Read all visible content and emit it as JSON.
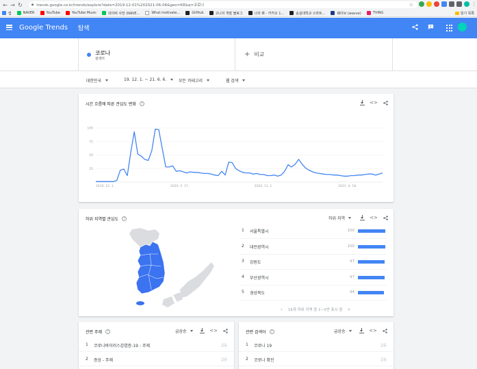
{
  "browser": {
    "url": "trends.google.co.kr/trends/explore?date=2019-12-01%202021-06-06&geo=KR&q=코로나",
    "bookmarks": [
      {
        "label": "앱",
        "color": "#4285f4"
      },
      {
        "label": "NAVER",
        "color": "#03c75a"
      },
      {
        "label": "YouTube",
        "color": "#ff0000"
      },
      {
        "label": "YouTube Music",
        "color": "#ff0000"
      },
      {
        "label": "네이버 사전 (NAVE...",
        "color": "#03c75a"
      },
      {
        "label": "What motivate...",
        "color": "#ffffff"
      },
      {
        "label": "GitHub",
        "color": "#202124"
      },
      {
        "label": "고니의 개발 블로그",
        "color": "#202124"
      },
      {
        "label": "나의 뽀 - 카카오 1...",
        "color": "#202124"
      },
      {
        "label": "숭실대학교 스마트...",
        "color": "#202124"
      },
      {
        "label": "웨이브 (wavve)",
        "color": "#1e3a8a"
      },
      {
        "label": "TVING",
        "color": "#e91e63"
      }
    ],
    "other_bookmarks": "읽기 목록"
  },
  "header": {
    "logo_google": "Google",
    "logo_trends": "Trends",
    "title": "탐색"
  },
  "term": {
    "name": "코로나",
    "type": "검색어",
    "color": "#4285f4",
    "compare_label": "비교"
  },
  "filters": {
    "region": "대한민국",
    "date": "19. 12. 1. ~ 21. 6. 6.",
    "category": "모든 카테고리",
    "search_type": "웹 검색"
  },
  "interest_over_time": {
    "title": "시간 흐름에 따른 관심도 변화"
  },
  "chart_data": {
    "type": "line",
    "ylim": [
      0,
      100
    ],
    "yticks": [
      25,
      50,
      75,
      100
    ],
    "x_tick_labels": [
      "2019. 12. 1.",
      "2020. 5. 17.",
      "2020. 11. 1.",
      "2021. 4. 18."
    ],
    "x_tick_index": [
      0,
      24,
      48,
      72
    ],
    "grid": true,
    "series": [
      {
        "color": "#4285f4",
        "values": [
          1,
          1,
          1,
          1,
          1,
          1,
          3,
          22,
          24,
          12,
          55,
          93,
          52,
          48,
          42,
          40,
          58,
          98,
          97,
          62,
          28,
          28,
          30,
          20,
          21,
          19,
          17,
          19,
          18,
          18,
          17,
          16,
          16,
          15,
          13,
          12,
          20,
          13,
          37,
          36,
          25,
          21,
          18,
          17,
          17,
          15,
          16,
          14,
          14,
          12,
          12,
          13,
          11,
          13,
          20,
          32,
          28,
          33,
          42,
          33,
          26,
          22,
          19,
          17,
          16,
          15,
          14,
          14,
          13,
          13,
          12,
          11,
          11,
          12,
          12,
          13,
          13,
          14,
          15,
          15,
          13,
          15,
          17
        ]
      }
    ]
  },
  "region": {
    "title": "하위 지역별 관심도",
    "subregion_label": "하위 지역",
    "items": [
      {
        "rank": "1",
        "name": "서울특별시",
        "value": 100
      },
      {
        "rank": "2",
        "name": "대전광역시",
        "value": 100
      },
      {
        "rank": "3",
        "name": "강원도",
        "value": 97
      },
      {
        "rank": "4",
        "name": "부산광역시",
        "value": 97
      },
      {
        "rank": "5",
        "name": "경상북도",
        "value": 94
      }
    ],
    "pager_text": "16개 하위 지역 중 1~5번 표시 중"
  },
  "related_topics": {
    "title": "관련 주제",
    "metric": "급상승",
    "items": [
      {
        "rank": "1",
        "name": "코로나바이러스감염증-19 - 주제",
        "value": "급등"
      },
      {
        "rank": "2",
        "name": "증상 - 주제",
        "value": "급등"
      }
    ]
  },
  "related_queries": {
    "title": "관련 검색어",
    "metric": "급상승",
    "items": [
      {
        "rank": "1",
        "name": "코로나 19",
        "value": "급등"
      },
      {
        "rank": "2",
        "name": "코로나 확진",
        "value": "급등"
      }
    ]
  }
}
